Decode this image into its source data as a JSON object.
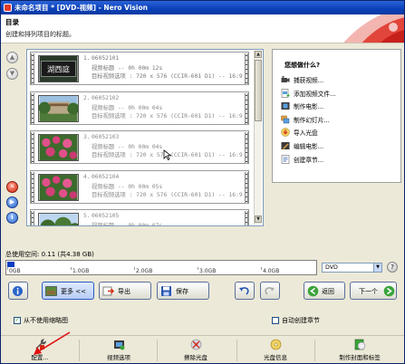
{
  "window": {
    "title": "未命名项目 * [DVD-视频] - Nero Vision"
  },
  "header": {
    "heading": "目录",
    "subtitle": "创建和排列项目的标题。"
  },
  "titles": [
    {
      "num": "1.",
      "name": "06052101",
      "line2": "视频标题 -- 0h 00m 12s",
      "line3": "目标视频选项 : 720 x 576 (CCIR-601 D1) -- 16:9",
      "thumb": "calligraphy-sign"
    },
    {
      "num": "2.",
      "name": "06052102",
      "line2": "视频标题 -- 0h 00m 04s",
      "line3": "目标视频选项 : 720 x 576 (CCIR-601 D1) -- 16:9",
      "thumb": "building-trees"
    },
    {
      "num": "3.",
      "name": "06052103",
      "line2": "视频标题 -- 0h 00m 04s",
      "line3": "目标视频选项 : 720 x 576 (CCIR-601 D1) -- 16:9",
      "thumb": "pink-flowers"
    },
    {
      "num": "4.",
      "name": "06052104",
      "line2": "视频标题 -- 0h 00m 05s",
      "line3": "目标视频选项 : 720 x 576 (CCIR-601 D1) -- 16:9",
      "thumb": "pink-flowers"
    },
    {
      "num": "5.",
      "name": "06052105",
      "line2": "视频标题 -- 0h 00m 07s",
      "line3": "",
      "thumb": "trees-sky"
    }
  ],
  "tasks": {
    "title": "您想做什么?",
    "items": [
      {
        "label": "捕获视频...",
        "icon": "camcorder-icon"
      },
      {
        "label": "添加视频文件...",
        "icon": "add-file-icon"
      },
      {
        "label": "制作电影...",
        "icon": "film-icon"
      },
      {
        "label": "制作幻灯片...",
        "icon": "slideshow-icon"
      },
      {
        "label": "导入光盘",
        "icon": "disc-import-icon"
      },
      {
        "label": "编辑电影...",
        "icon": "film-edit-icon"
      },
      {
        "label": "创建章节...",
        "icon": "chapter-icon"
      }
    ]
  },
  "usage": {
    "label": "总使用空间:  0.11  (共4.38 GB)",
    "used_gb": 0.11,
    "total_gb": 4.38,
    "ticks": [
      "0GB",
      "1.0GB",
      "2.0GB",
      "3.0GB",
      "4.0GB"
    ],
    "disc_type": "DVD"
  },
  "toolbar": {
    "more": "更多 <<",
    "export": "导出",
    "save": "保存",
    "back": "返回",
    "next": "下一个"
  },
  "options": {
    "no_thumbnails": "从不使用缩略图",
    "no_thumbnails_checked": true,
    "auto_chapters": "自动创建章节",
    "auto_chapters_checked": false
  },
  "bottombar": {
    "items": [
      {
        "label": "配置...",
        "icon": "wrench-icon"
      },
      {
        "label": "视频选项",
        "icon": "film-settings-icon"
      },
      {
        "label": "擦除光盘",
        "icon": "erase-disc-icon"
      },
      {
        "label": "光盘信息",
        "icon": "disc-info-icon"
      },
      {
        "label": "制作封面和标签",
        "icon": "cover-label-icon"
      }
    ]
  },
  "colors": {
    "titlebar": "#0a3fb8",
    "usage_fill": "#0a3fc0",
    "accent_red": "#d42a10"
  }
}
